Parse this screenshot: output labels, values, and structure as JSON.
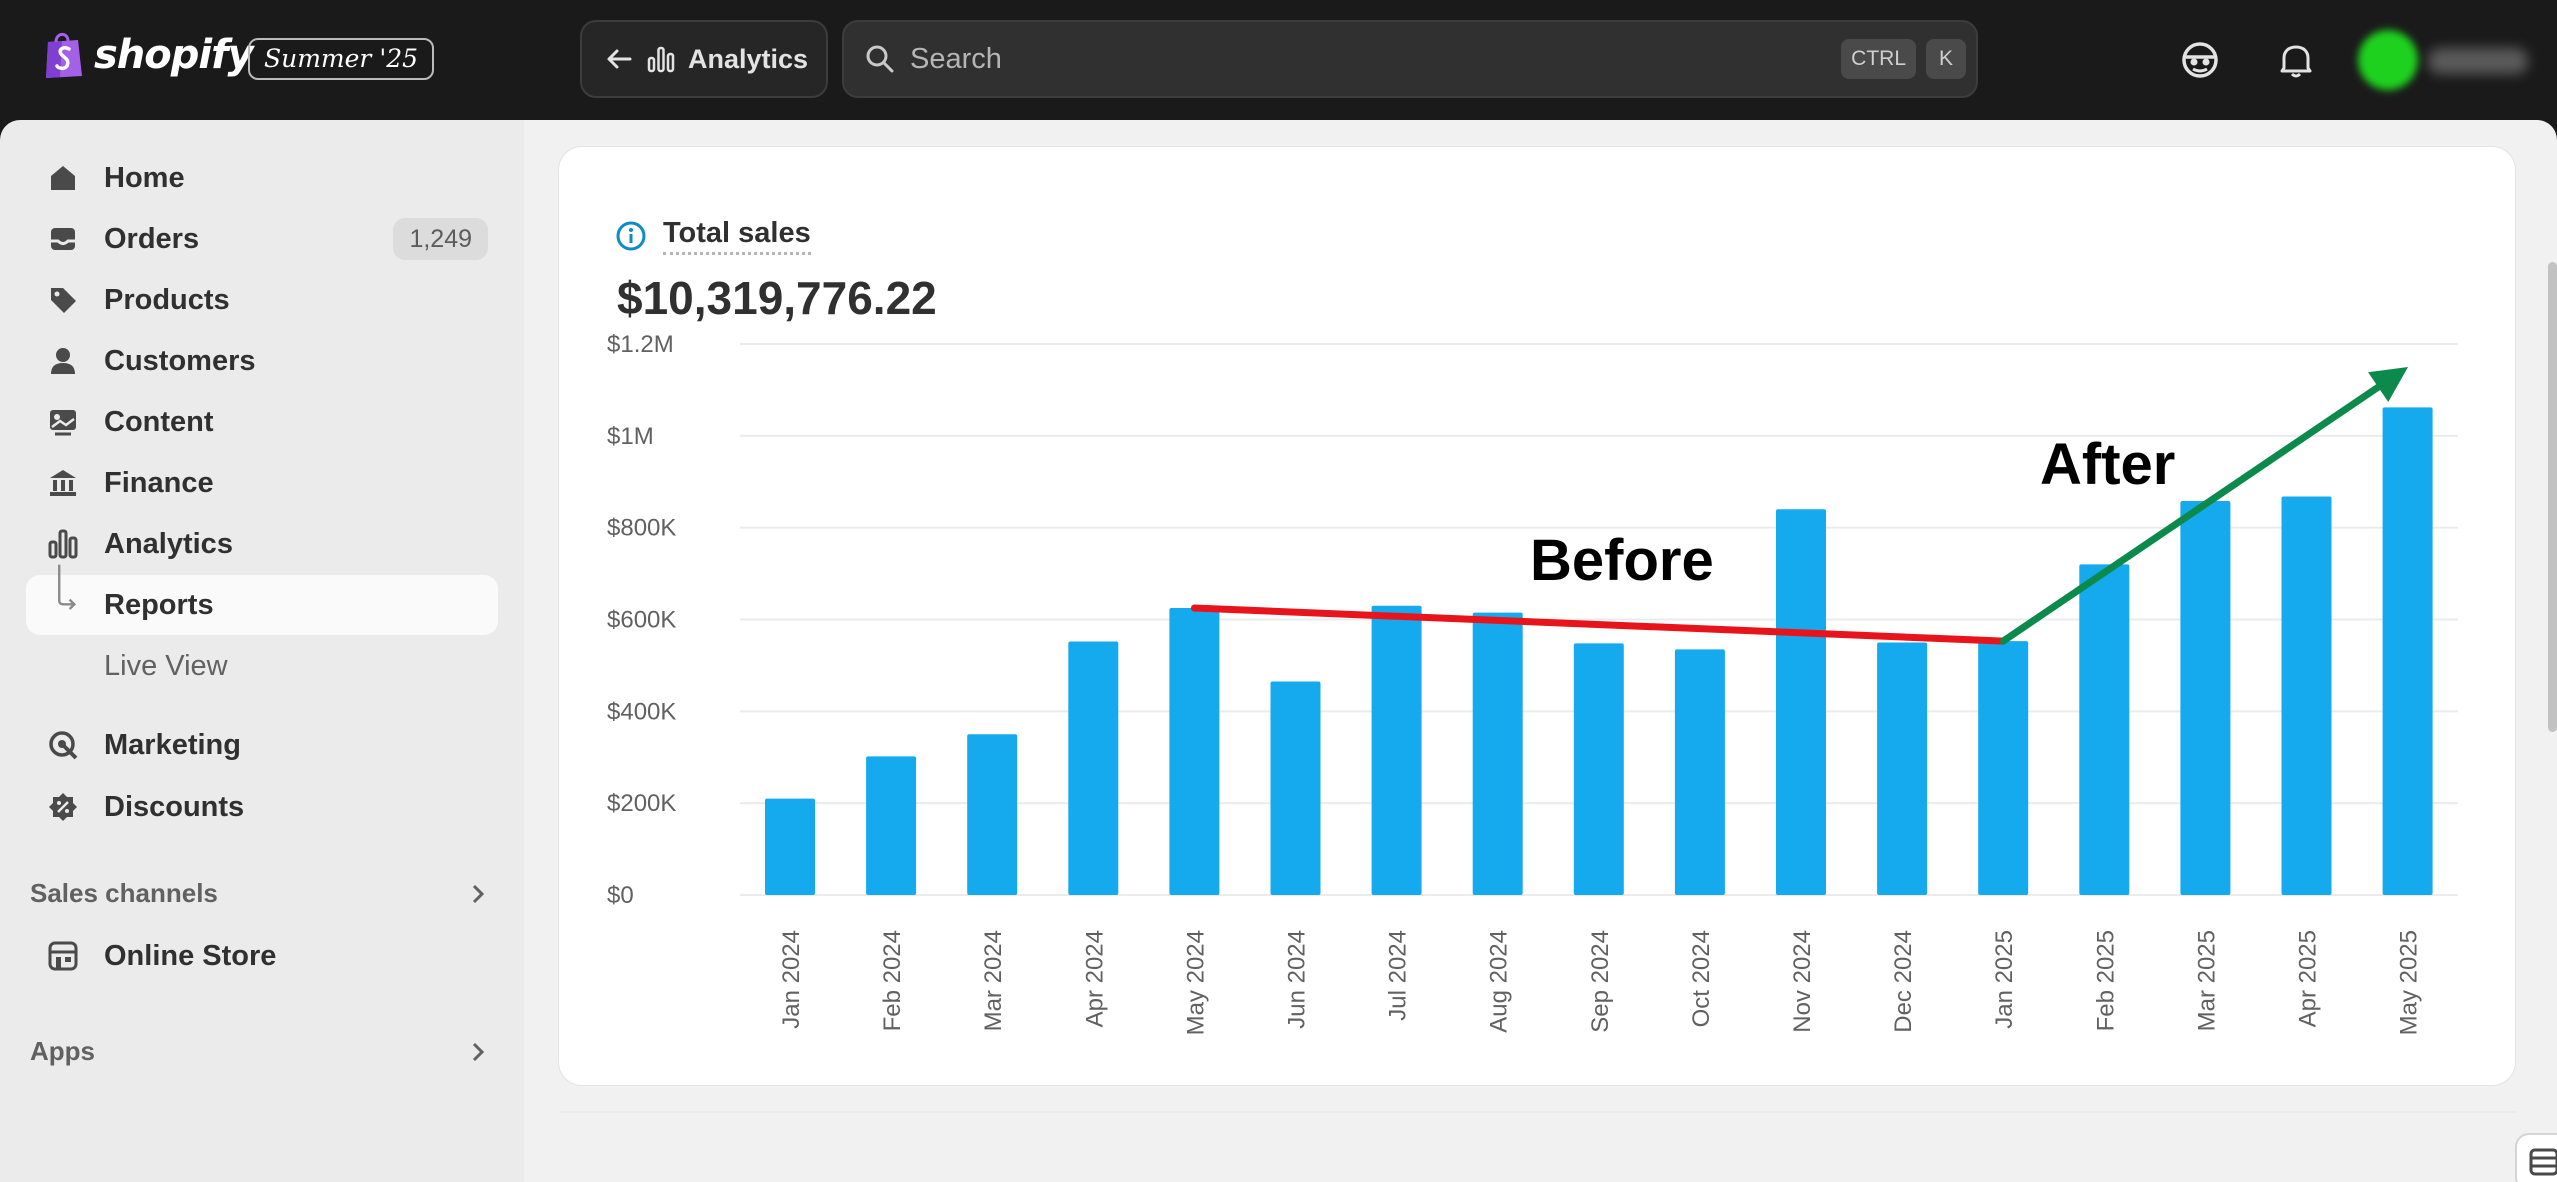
{
  "brand": {
    "name": "shopify",
    "edition": "Summer '25"
  },
  "topbar": {
    "back_label": "Analytics",
    "search_placeholder": "Search",
    "shortcut_keys": [
      "CTRL",
      "K"
    ]
  },
  "sidebar": {
    "items": [
      {
        "label": "Home",
        "icon": "home-icon"
      },
      {
        "label": "Orders",
        "icon": "orders-icon",
        "count": "1,249"
      },
      {
        "label": "Products",
        "icon": "tag-icon"
      },
      {
        "label": "Customers",
        "icon": "person-icon"
      },
      {
        "label": "Content",
        "icon": "content-icon"
      },
      {
        "label": "Finance",
        "icon": "bank-icon"
      },
      {
        "label": "Analytics",
        "icon": "bar-chart-icon"
      },
      {
        "label": "Reports",
        "icon": "sub-arrow-icon"
      },
      {
        "label": "Live View"
      },
      {
        "label": "Marketing",
        "icon": "target-icon"
      },
      {
        "label": "Discounts",
        "icon": "discount-icon"
      }
    ],
    "sales_channels_label": "Sales channels",
    "online_store_label": "Online Store",
    "apps_label": "Apps"
  },
  "card": {
    "title": "Total sales",
    "value": "$10,319,776.22"
  },
  "chart_data": {
    "type": "bar",
    "title": "Total sales",
    "categories": [
      "Jan 2024",
      "Feb 2024",
      "Mar 2024",
      "Apr 2024",
      "May 2024",
      "Jun 2024",
      "Jul 2024",
      "Aug 2024",
      "Sep 2024",
      "Oct 2024",
      "Nov 2024",
      "Dec 2024",
      "Jan 2025",
      "Feb 2025",
      "Mar 2025",
      "Apr 2025",
      "May 2025"
    ],
    "values": [
      210000,
      302000,
      350000,
      552000,
      625000,
      465000,
      630000,
      615000,
      548000,
      535000,
      840000,
      550000,
      553000,
      720000,
      858000,
      868000,
      1062000
    ],
    "yticks": [
      "$0",
      "$200K",
      "$400K",
      "$600K",
      "$800K",
      "$1M",
      "$1.2M"
    ],
    "ytick_values": [
      0,
      200000,
      400000,
      600000,
      800000,
      1000000,
      1200000
    ],
    "ylim": [
      0,
      1200000
    ],
    "xlabel": "",
    "ylabel": "",
    "grid": true,
    "bar_color": "#15aaed",
    "annotations": [
      {
        "text": "Before",
        "color": "#e8141c",
        "from": [
          "May 2024",
          625000
        ],
        "to": [
          "Jan 2025",
          553000
        ]
      },
      {
        "text": "After",
        "color": "#0b8a4c",
        "from": [
          "Jan 2025",
          553000
        ],
        "to": [
          "May 2025",
          1150000
        ]
      }
    ]
  }
}
